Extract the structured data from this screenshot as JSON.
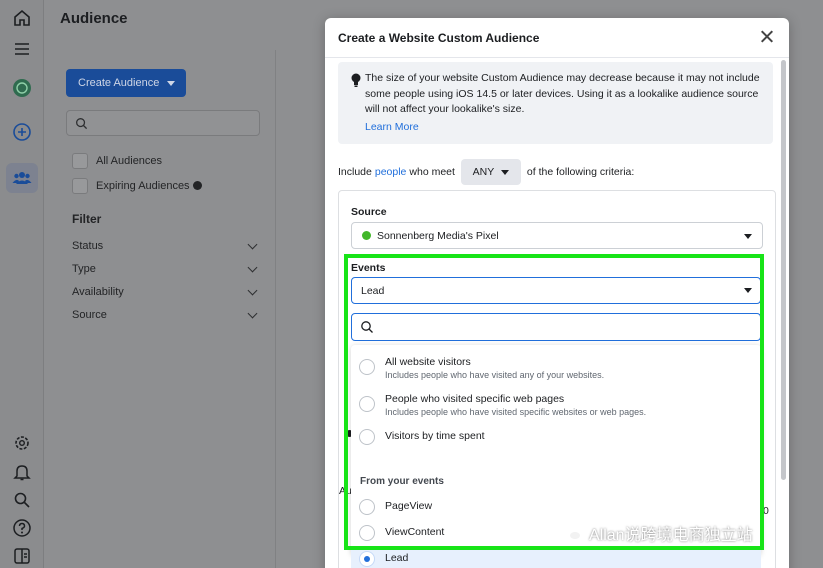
{
  "page": {
    "title": "Audience",
    "create_button": "Create Audience",
    "search_placeholder": "",
    "checkboxes": [
      "All Audiences",
      "Expiring Audiences"
    ],
    "filter_title": "Filter",
    "filters": [
      "Status",
      "Type",
      "Availability",
      "Source"
    ]
  },
  "rail": {
    "icons": [
      "home-icon",
      "menu-icon",
      "account-icon",
      "plus-circle-icon",
      "audiences-icon",
      "gear-icon",
      "bell-icon",
      "search-icon",
      "help-icon",
      "report-icon"
    ]
  },
  "modal": {
    "title": "Create a Website Custom Audience",
    "notice": "The size of your website Custom Audience may decrease because it may not include some people using iOS 14.5 or later devices. Using it as a lookalike audience source will not affect your lookalike's size.",
    "learn_more": "Learn More",
    "criteria_prefix": "Include",
    "criteria_link": "people",
    "criteria_mid": "who meet",
    "criteria_match": "ANY",
    "criteria_suffix": "of the following criteria:",
    "source_label": "Source",
    "source_value": "Sonnenberg Media's Pixel",
    "events_label": "Events",
    "events_value": "Lead",
    "events_search_placeholder": "",
    "options": [
      {
        "title": "All website visitors",
        "desc": "Includes people who have visited any of your websites."
      },
      {
        "title": "People who visited specific web pages",
        "desc": "Includes people who have visited specific websites or web pages."
      },
      {
        "title": "Visitors by time spent",
        "desc": ""
      }
    ],
    "group_label": "From your events",
    "event_options": [
      {
        "title": "PageView",
        "selected": false
      },
      {
        "title": "ViewContent",
        "selected": false
      },
      {
        "title": "Lead",
        "selected": true
      }
    ],
    "behind_fragments": {
      "left_a": "Au",
      "right_a": "0"
    }
  },
  "watermark": "Allan说跨境电商独立站",
  "colors": {
    "accent": "#216fdb",
    "highlight": "#18e418",
    "pixel_status": "#42b72a",
    "create_button": "#1a4c99"
  }
}
